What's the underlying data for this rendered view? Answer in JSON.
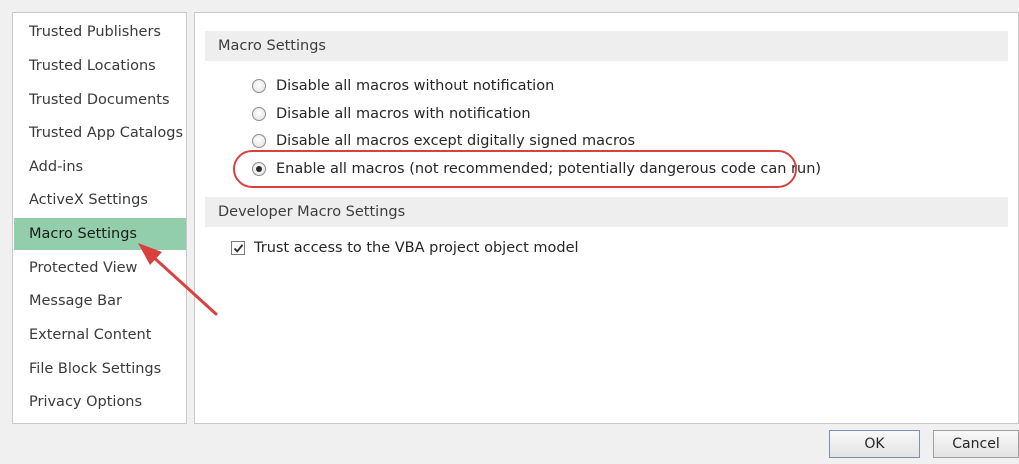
{
  "sidebar": {
    "items": [
      {
        "label": "Trusted Publishers"
      },
      {
        "label": "Trusted Locations"
      },
      {
        "label": "Trusted Documents"
      },
      {
        "label": "Trusted App Catalogs"
      },
      {
        "label": "Add-ins"
      },
      {
        "label": "ActiveX Settings"
      },
      {
        "label": "Macro Settings",
        "selected": true
      },
      {
        "label": "Protected View"
      },
      {
        "label": "Message Bar"
      },
      {
        "label": "External Content"
      },
      {
        "label": "File Block Settings"
      },
      {
        "label": "Privacy Options"
      }
    ]
  },
  "macro_settings": {
    "title": "Macro Settings",
    "options": [
      {
        "label": "Disable all macros without notification",
        "selected": false
      },
      {
        "label": "Disable all macros with notification",
        "selected": false
      },
      {
        "label": "Disable all macros except digitally signed macros",
        "selected": false
      },
      {
        "label": "Enable all macros (not recommended; potentially dangerous code can run)",
        "selected": true
      }
    ]
  },
  "developer_macro_settings": {
    "title": "Developer Macro Settings",
    "trust_vba_label": "Trust access to the VBA project object model",
    "trust_vba_checked": true
  },
  "buttons": {
    "ok": "OK",
    "cancel": "Cancel"
  },
  "annotation_color": "#d9413f",
  "selected_item_color": "#93ceac"
}
